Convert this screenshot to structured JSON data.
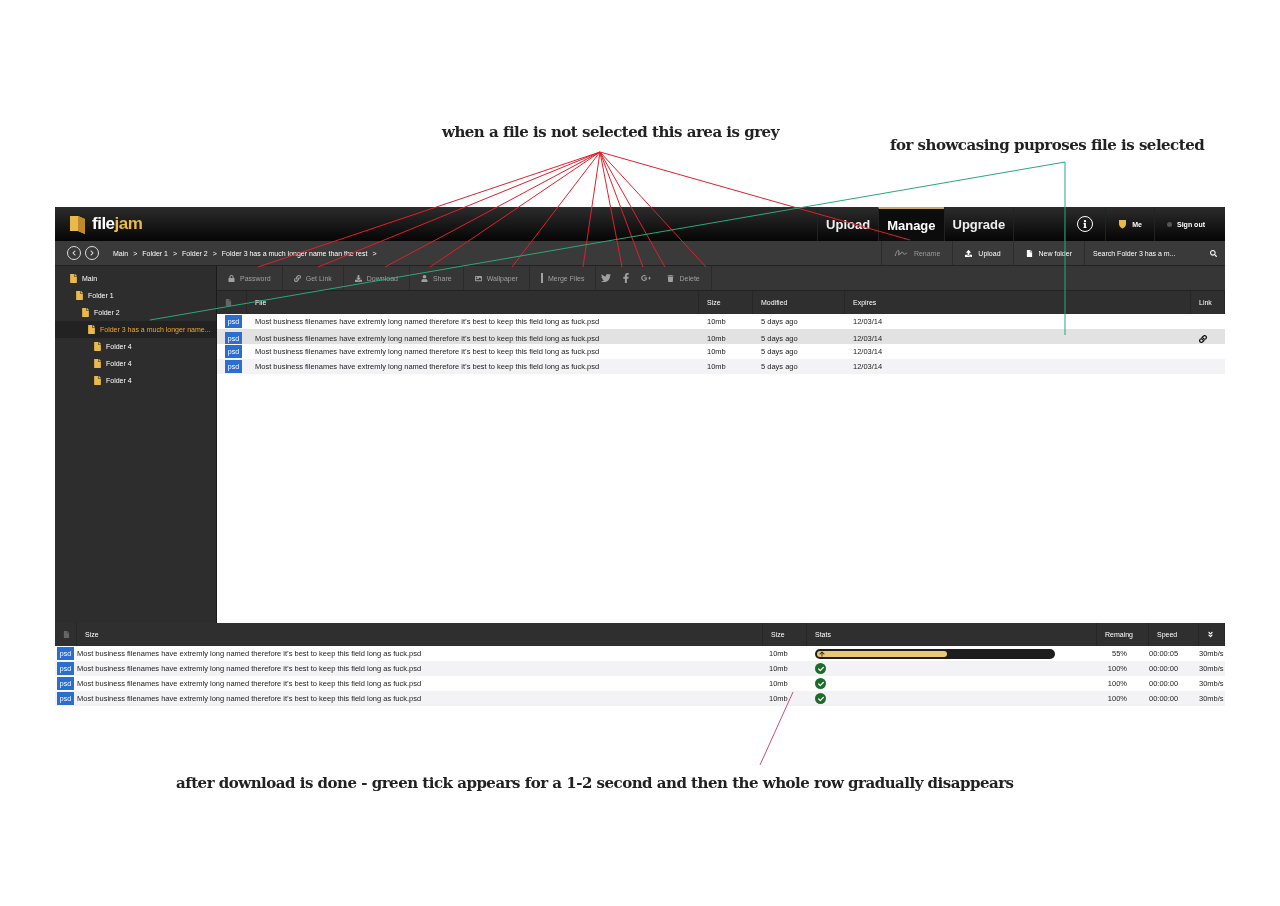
{
  "annotations": [
    {
      "text": "when a file is not selected this area is grey"
    },
    {
      "text": "for showcasing puproses file is selected"
    },
    {
      "text": "after download is done - green tick appears for a 1-2 second and then the whole row gradually disappears"
    }
  ],
  "header": {
    "logo": {
      "part_1": "file",
      "part_2": "jam"
    },
    "nav": [
      {
        "label": "Upload",
        "selected": false
      },
      {
        "label": "Manage",
        "selected": true
      },
      {
        "label": "Upgrade",
        "selected": false
      }
    ],
    "user": "Me",
    "sign_out": "Sign out"
  },
  "path_bar": {
    "breadcrumb": [
      "Main",
      "Folder 1",
      "Folder 2",
      "Folder 3 has a much longer name than the rest"
    ],
    "separator": ">",
    "actions": [
      {
        "label": "Rename",
        "disabled": true
      },
      {
        "label": "Upload",
        "disabled": false
      },
      {
        "label": "New folder",
        "disabled": false
      }
    ],
    "search": {
      "placeholder": "Search Folder 3 has a m..."
    }
  },
  "sidebar": {
    "tree": [
      {
        "label": "Main",
        "selected": false,
        "children": [
          {
            "label": "Folder 1",
            "selected": false,
            "children": [
              {
                "label": "Folder 2",
                "selected": false,
                "children": [
                  {
                    "label": "Folder 3 has a much longer name...",
                    "selected": true,
                    "children": [
                      {
                        "label": "Folder 4",
                        "selected": false
                      },
                      {
                        "label": "Folder 4",
                        "selected": false
                      },
                      {
                        "label": "Folder 4",
                        "selected": false
                      }
                    ]
                  }
                ]
              }
            ]
          }
        ]
      }
    ]
  },
  "toolbar": [
    {
      "kind": "text",
      "label": "Password",
      "disabled": true
    },
    {
      "kind": "text",
      "label": "Get Link",
      "disabled": true
    },
    {
      "kind": "text",
      "label": "Download",
      "disabled": true
    },
    {
      "kind": "text",
      "label": "Share",
      "disabled": true
    },
    {
      "kind": "text",
      "label": "Wallpaper",
      "disabled": true
    },
    {
      "kind": "text",
      "label": "Merge Files",
      "disabled": true
    },
    {
      "kind": "twitter",
      "disabled": true
    },
    {
      "kind": "facebook",
      "disabled": true
    },
    {
      "kind": "googleplus",
      "disabled": true
    },
    {
      "kind": "text",
      "label": "Delete",
      "disabled": true
    }
  ],
  "files": {
    "columns": [
      "File",
      "Size",
      "Modified",
      "Expires",
      "Link"
    ],
    "rows": [
      {
        "name": "Most business filenames have extremly long named therefore it’s best to keep this field long as fuck.psd",
        "type": "psd",
        "size": "10mb",
        "modified": "5 days ago",
        "expires": "12/03/14",
        "selected": false
      },
      {
        "name": "Most business filenames have extremly long named therefore it’s best to keep this field long as fuck.psd",
        "type": "psd",
        "size": "10mb",
        "modified": "5 days ago",
        "expires": "12/03/14",
        "selected": true
      },
      {
        "name": "Most business filenames have extremly long named therefore it’s best to keep this field long as fuck.psd",
        "type": "psd",
        "size": "10mb",
        "modified": "5 days ago",
        "expires": "12/03/14",
        "selected": false
      },
      {
        "name": "Most business filenames have extremly long named therefore it’s best to keep this field long as fuck.psd",
        "type": "psd",
        "size": "10mb",
        "modified": "5 days ago",
        "expires": "12/03/14",
        "selected": false
      }
    ]
  },
  "transfers": {
    "columns": [
      "Size",
      "Size",
      "Stats",
      "Remaing",
      "Speed"
    ],
    "rows": [
      {
        "kind": "progress",
        "name": "Most business filenames have extremly long named therefore it’s best to keep this field long as fuck.psd",
        "type": "psd",
        "size": "10mb",
        "level": 0.55,
        "percent": "55%",
        "remaining": "00:00:05",
        "speed": "30mb/s"
      },
      {
        "kind": "done",
        "name": "Most business filenames have extremly long named therefore it’s best to keep this field long as fuck.psd",
        "type": "psd",
        "size": "10mb",
        "percent": "100%",
        "remaining": "00:00:00",
        "speed": "30mb/s"
      },
      {
        "kind": "done",
        "name": "Most business filenames have extremly long named therefore it’s best to keep this field long as fuck.psd",
        "type": "psd",
        "size": "10mb",
        "percent": "100%",
        "remaining": "00:00:00",
        "speed": "30mb/s"
      },
      {
        "kind": "done",
        "name": "Most business filenames have extremly long named therefore it’s best to keep this field long as fuck.psd",
        "type": "psd",
        "size": "10mb",
        "percent": "100%",
        "remaining": "00:00:00",
        "speed": "30mb/s"
      }
    ]
  }
}
